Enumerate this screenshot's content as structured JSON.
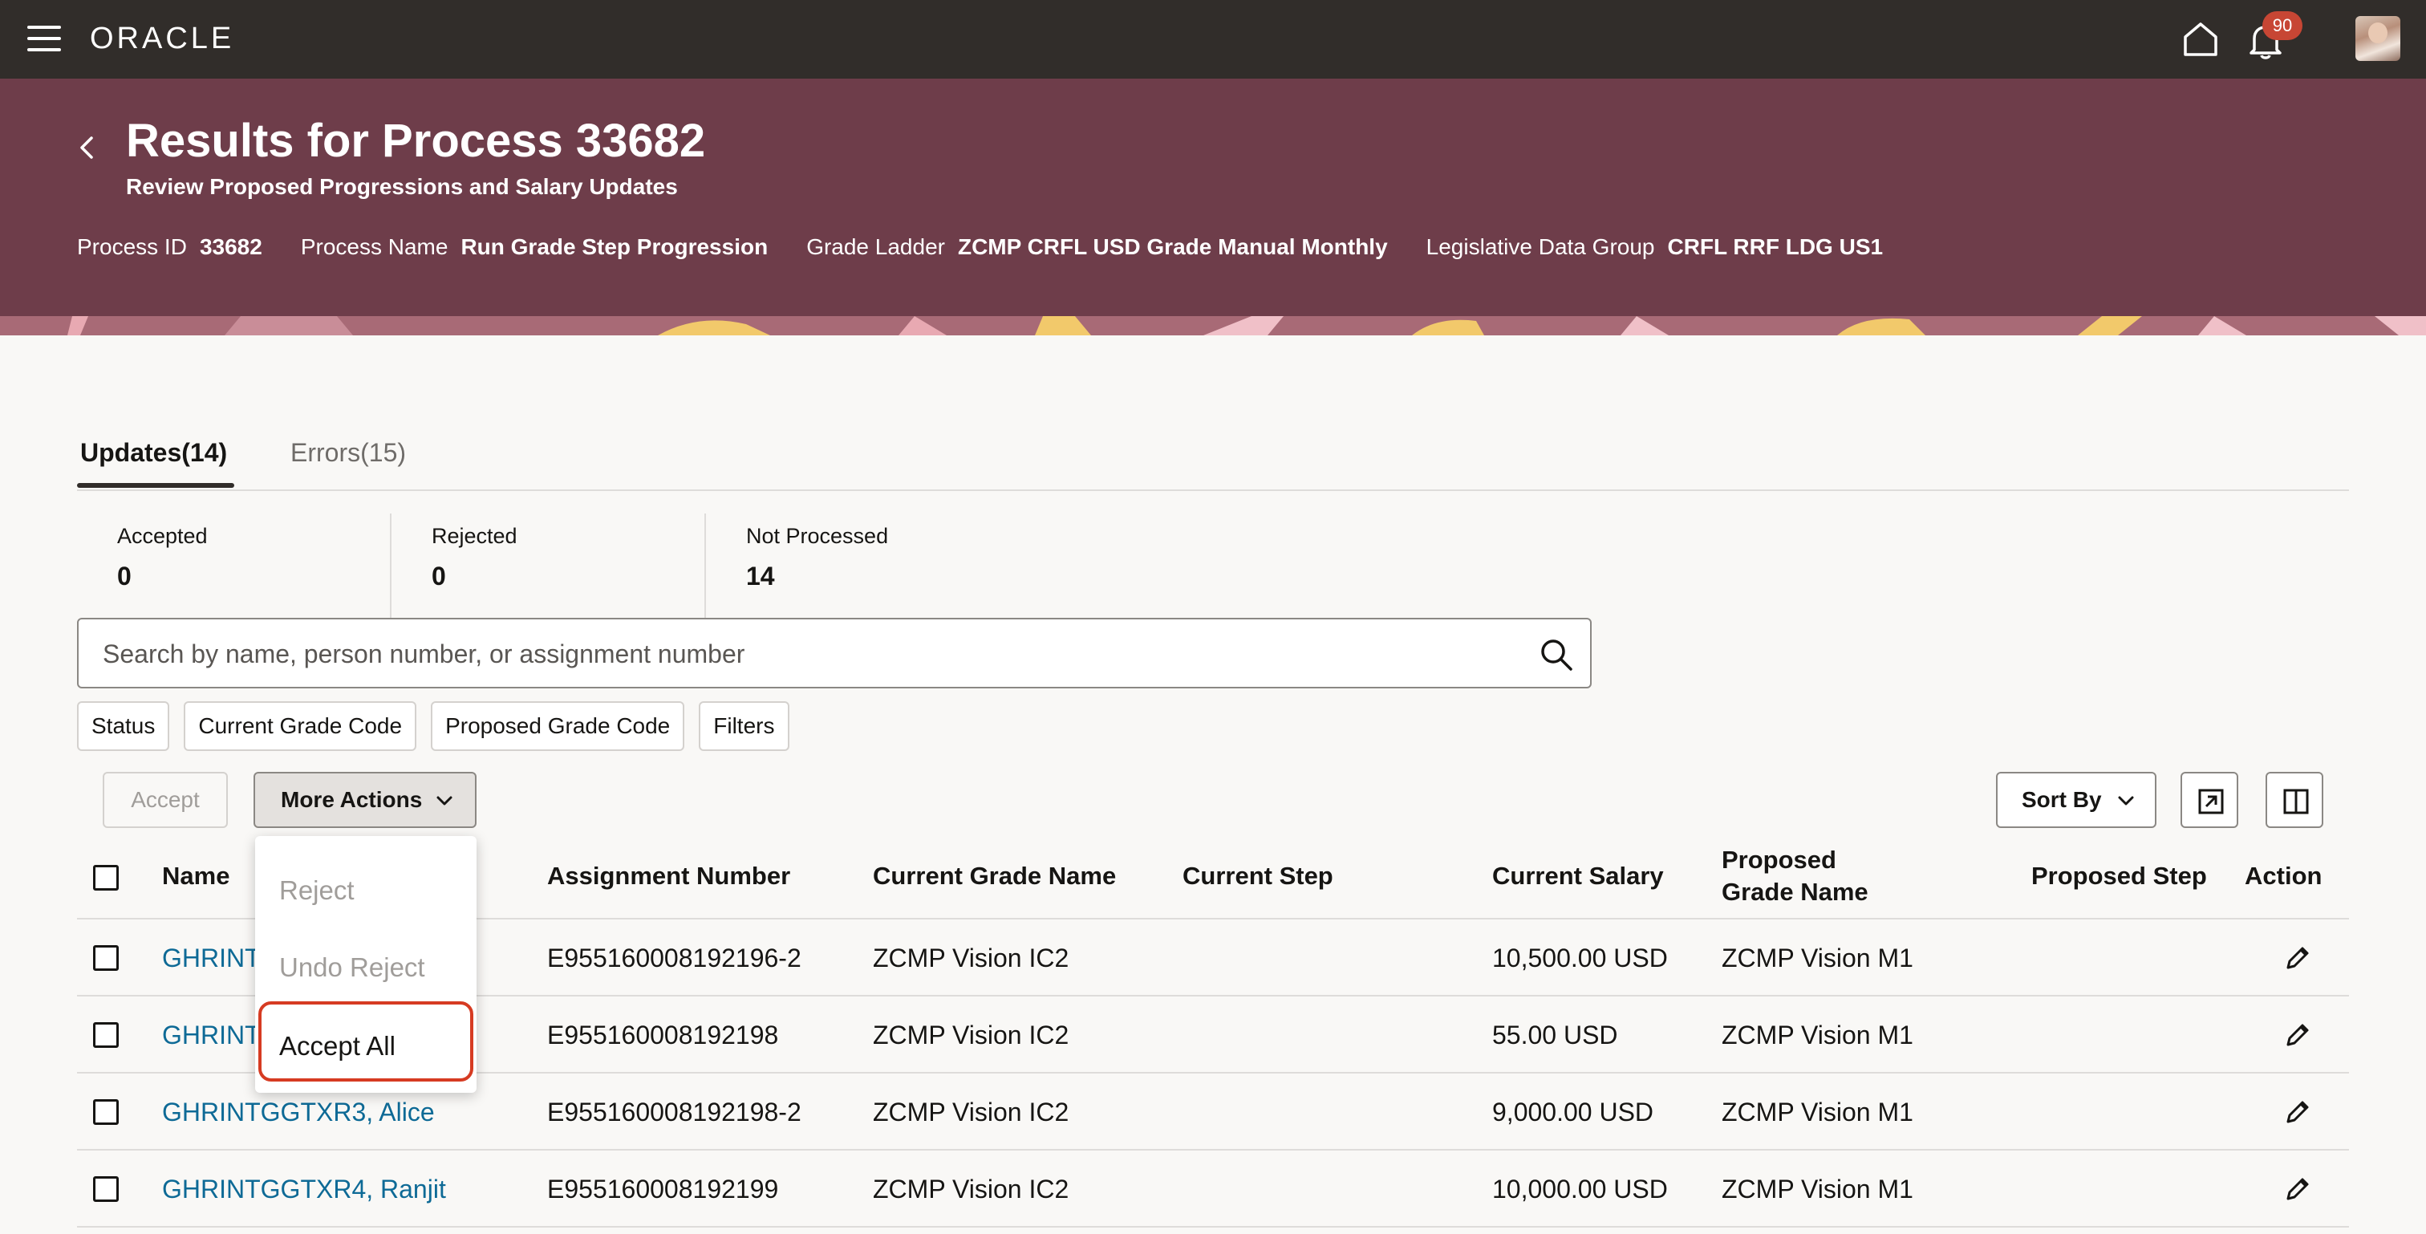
{
  "topbar": {
    "brand": "ORACLE",
    "notification_count": "90",
    "icons": [
      "menu-icon",
      "home-icon",
      "bell-icon",
      "user-avatar"
    ]
  },
  "header": {
    "title": "Results for Process 33682",
    "subtitle": "Review Proposed Progressions and Salary Updates",
    "meta": [
      {
        "label": "Process ID",
        "value": "33682"
      },
      {
        "label": "Process Name",
        "value": "Run Grade Step Progression"
      },
      {
        "label": "Grade Ladder",
        "value": "ZCMP CRFL USD Grade Manual Monthly"
      },
      {
        "label": "Legislative Data Group",
        "value": "CRFL RRF LDG US1"
      }
    ],
    "band_color": "#6e3d4a"
  },
  "tabs": [
    {
      "label": "Updates(14)",
      "active": true
    },
    {
      "label": "Errors(15)",
      "active": false
    }
  ],
  "summary": [
    {
      "label": "Accepted",
      "value": "0"
    },
    {
      "label": "Rejected",
      "value": "0"
    },
    {
      "label": "Not Processed",
      "value": "14"
    }
  ],
  "search": {
    "placeholder": "Search by name, person number, or assignment number",
    "value": ""
  },
  "filters": [
    "Status",
    "Current Grade Code",
    "Proposed Grade Code",
    "Filters"
  ],
  "toolbar": {
    "accept_label": "Accept",
    "more_actions_label": "More Actions",
    "sort_label": "Sort By"
  },
  "menu": {
    "items": [
      {
        "label": "Reject",
        "enabled": false
      },
      {
        "label": "Undo Reject",
        "enabled": false
      },
      {
        "label": "Accept All",
        "enabled": true,
        "highlighted": true
      }
    ]
  },
  "table": {
    "columns": [
      "Name",
      "Assignment Number",
      "Current Grade Name",
      "Current Step",
      "Current Salary",
      "Proposed Grade Name",
      "Proposed Step",
      "Action"
    ],
    "rows": [
      {
        "name": "GHRINT",
        "assignment": "E955160008192196-2",
        "current_grade": "ZCMP Vision IC2",
        "current_step": "",
        "current_salary": "10,500.00 USD",
        "proposed_grade": "ZCMP Vision M1",
        "proposed_step": ""
      },
      {
        "name": "GHRINT",
        "assignment": "E955160008192198",
        "current_grade": "ZCMP Vision IC2",
        "current_step": "",
        "current_salary": "55.00 USD",
        "proposed_grade": "ZCMP Vision M1",
        "proposed_step": ""
      },
      {
        "name": "GHRINTGGTXR3, Alice",
        "assignment": "E955160008192198-2",
        "current_grade": "ZCMP Vision IC2",
        "current_step": "",
        "current_salary": "9,000.00 USD",
        "proposed_grade": "ZCMP Vision M1",
        "proposed_step": ""
      },
      {
        "name": "GHRINTGGTXR4, Ranjit",
        "assignment": "E955160008192199",
        "current_grade": "ZCMP Vision IC2",
        "current_step": "",
        "current_salary": "10,000.00 USD",
        "proposed_grade": "ZCMP Vision M1",
        "proposed_step": ""
      }
    ]
  }
}
